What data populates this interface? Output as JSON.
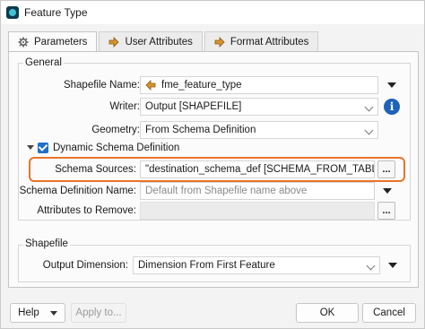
{
  "window": {
    "title": "Feature Type"
  },
  "tabs": [
    {
      "label": "Parameters",
      "icon": "gear-icon"
    },
    {
      "label": "User Attributes",
      "icon": "arrow-right-icon"
    },
    {
      "label": "Format Attributes",
      "icon": "arrow-right-icon"
    }
  ],
  "general": {
    "title": "General",
    "shapefile_name": {
      "label": "Shapefile Name:",
      "value": "fme_feature_type"
    },
    "writer": {
      "label": "Writer:",
      "value": "Output [SHAPEFILE]"
    },
    "geometry": {
      "label": "Geometry:",
      "value": "From Schema Definition"
    },
    "dynamic_schema": {
      "label": "Dynamic Schema Definition",
      "schema_sources": {
        "label": "Schema Sources:",
        "value": "\"destination_schema_def [SCHEMA_FROM_TABLE]\""
      },
      "schema_definition_name": {
        "label": "Schema Definition Name:",
        "placeholder": "Default from Shapefile name above"
      },
      "attributes_to_remove": {
        "label": "Attributes to Remove:",
        "value": ""
      }
    }
  },
  "shapefile": {
    "title": "Shapefile",
    "output_dimension": {
      "label": "Output Dimension:",
      "value": "Dimension From First Feature"
    }
  },
  "footer": {
    "help_label": "Help",
    "apply_label": "Apply to...",
    "ok_label": "OK",
    "cancel_label": "Cancel"
  },
  "colors": {
    "highlight": "#e8742a",
    "info": "#1e63b5",
    "checkbox": "#1f6fcb",
    "tab_arrow": "#d8932c"
  },
  "ellipsis": "...",
  "info_glyph": "i"
}
